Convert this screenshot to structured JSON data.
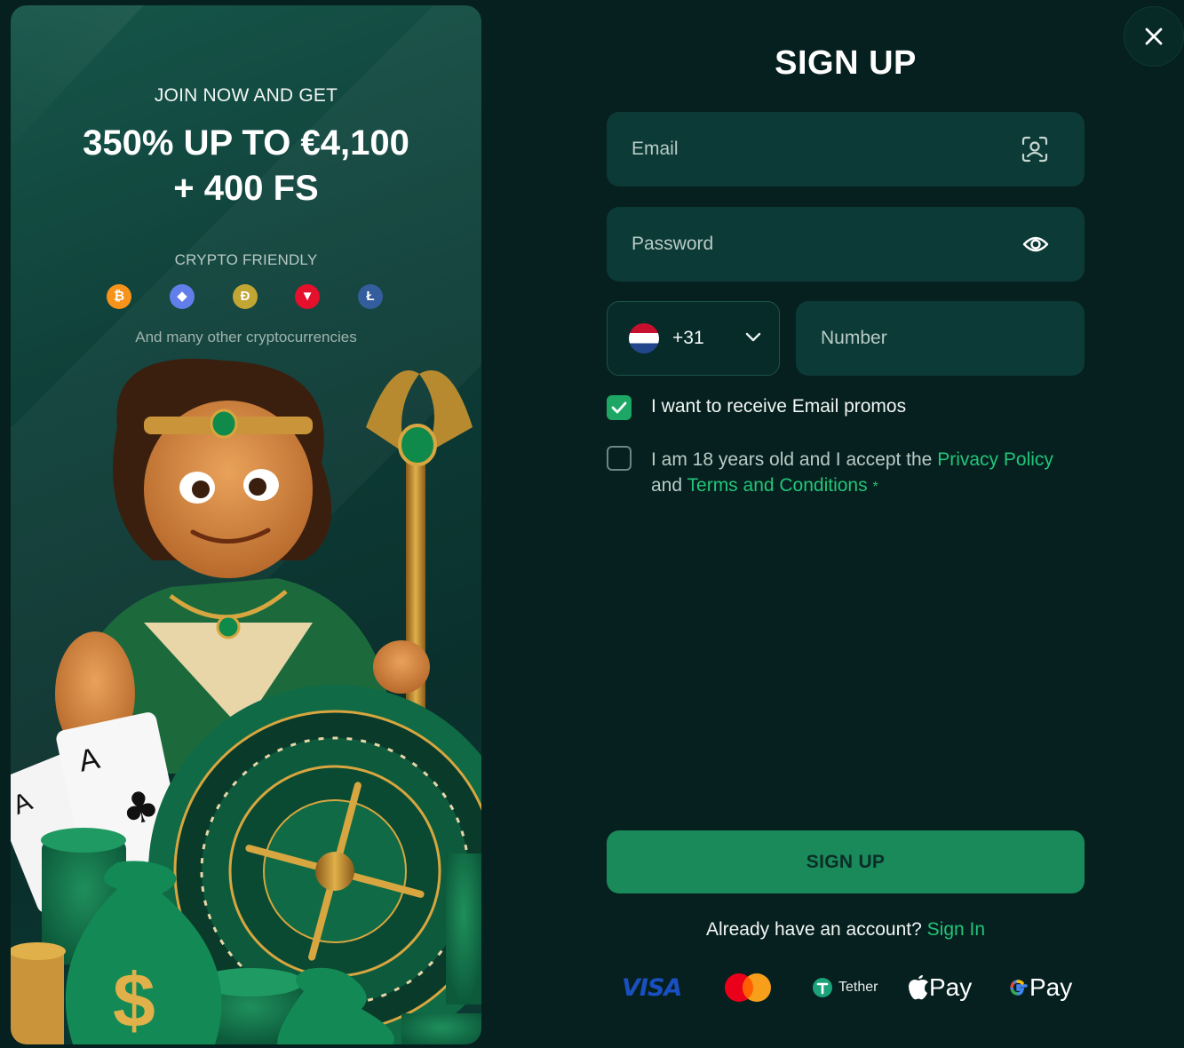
{
  "promo": {
    "intro": "JOIN NOW AND GET",
    "headline_line1": "350% UP TO €4,100",
    "headline_line2": "+ 400 FS",
    "crypto_label": "CRYPTO FRIENDLY",
    "coins": [
      {
        "name": "bitcoin-icon",
        "glyph": "₿",
        "color": "#f7931a"
      },
      {
        "name": "ethereum-icon",
        "glyph": "◆",
        "color": "#627eea"
      },
      {
        "name": "dogecoin-icon",
        "glyph": "Ð",
        "color": "#c2a633"
      },
      {
        "name": "tron-icon",
        "glyph": "▼",
        "color": "#e5102b"
      },
      {
        "name": "litecoin-icon",
        "glyph": "Ł",
        "color": "#345d9d"
      }
    ],
    "many_label": "And many other cryptocurrencies"
  },
  "form": {
    "title": "SIGN UP",
    "email_placeholder": "Email",
    "password_placeholder": "Password",
    "country_code": "+31",
    "number_placeholder": "Number",
    "promo_checkbox_label": "I want to receive Email promos",
    "promo_checked": true,
    "terms_checked": false,
    "terms_prefix": "I am 18 years old and I accept the",
    "privacy_link": "Privacy Policy",
    "terms_and": "and",
    "terms_link": "Terms and Conditions",
    "terms_asterisk": "*",
    "submit_label": "SIGN UP",
    "already_text": "Already have an account?",
    "signin_link": "Sign In"
  },
  "payments": {
    "visa_label": "VISA",
    "tether_label": "Tether",
    "apple_pay_label": "Pay",
    "google_pay_label": "Pay"
  },
  "colors": {
    "accent": "#22c57a",
    "button": "#1a8a5a",
    "background": "#05201e",
    "field": "#0c3a36"
  }
}
